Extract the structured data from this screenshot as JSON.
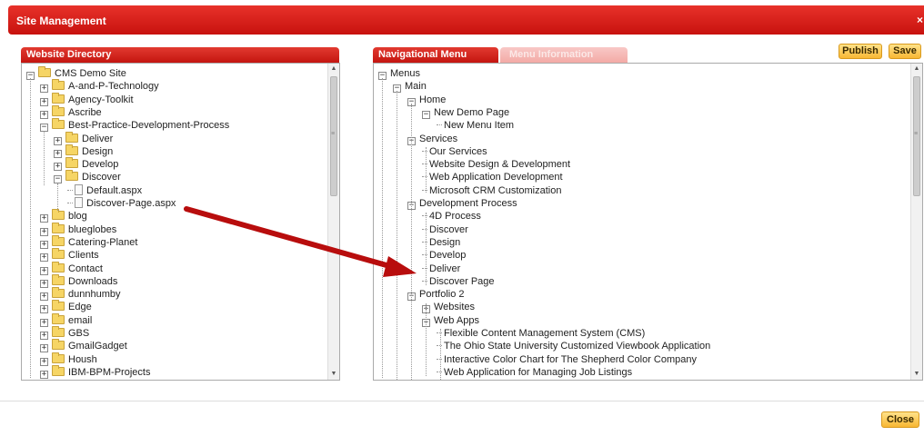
{
  "window": {
    "title": "Site Management",
    "close_label": "×"
  },
  "left_panel": {
    "tab": "Website Directory",
    "rows": [
      {
        "label": "CMS Demo Site",
        "indent": 0,
        "exp": "−",
        "icon": "folder"
      },
      {
        "label": "A-and-P-Technology",
        "indent": 1,
        "exp": "+",
        "icon": "folder"
      },
      {
        "label": "Agency-Toolkit",
        "indent": 1,
        "exp": "+",
        "icon": "folder"
      },
      {
        "label": "Ascribe",
        "indent": 1,
        "exp": "+",
        "icon": "folder"
      },
      {
        "label": "Best-Practice-Development-Process",
        "indent": 1,
        "exp": "−",
        "icon": "folder"
      },
      {
        "label": "Deliver",
        "indent": 2,
        "exp": "+",
        "icon": "folder"
      },
      {
        "label": "Design",
        "indent": 2,
        "exp": "+",
        "icon": "folder"
      },
      {
        "label": "Develop",
        "indent": 2,
        "exp": "+",
        "icon": "folder"
      },
      {
        "label": "Discover",
        "indent": 2,
        "exp": "−",
        "icon": "folder"
      },
      {
        "label": "Default.aspx",
        "indent": 3,
        "exp": "",
        "icon": "file"
      },
      {
        "label": "Discover-Page.aspx",
        "indent": 3,
        "exp": "",
        "icon": "file"
      },
      {
        "label": "blog",
        "indent": 1,
        "exp": "+",
        "icon": "folder"
      },
      {
        "label": "blueglobes",
        "indent": 1,
        "exp": "+",
        "icon": "folder"
      },
      {
        "label": "Catering-Planet",
        "indent": 1,
        "exp": "+",
        "icon": "folder"
      },
      {
        "label": "Clients",
        "indent": 1,
        "exp": "+",
        "icon": "folder"
      },
      {
        "label": "Contact",
        "indent": 1,
        "exp": "+",
        "icon": "folder"
      },
      {
        "label": "Downloads",
        "indent": 1,
        "exp": "+",
        "icon": "folder"
      },
      {
        "label": "dunnhumby",
        "indent": 1,
        "exp": "+",
        "icon": "folder"
      },
      {
        "label": "Edge",
        "indent": 1,
        "exp": "+",
        "icon": "folder"
      },
      {
        "label": "email",
        "indent": 1,
        "exp": "+",
        "icon": "folder"
      },
      {
        "label": "GBS",
        "indent": 1,
        "exp": "+",
        "icon": "folder"
      },
      {
        "label": "GmailGadget",
        "indent": 1,
        "exp": "+",
        "icon": "folder"
      },
      {
        "label": "Housh",
        "indent": 1,
        "exp": "+",
        "icon": "folder"
      },
      {
        "label": "IBM-BPM-Projects",
        "indent": 1,
        "exp": "+",
        "icon": "folder"
      }
    ]
  },
  "right_panel": {
    "tabs": [
      "Navigational Menu",
      "Menu Information"
    ],
    "publish_label": "Publish",
    "save_label": "Save",
    "rows": [
      {
        "label": "Menus",
        "indent": 0,
        "exp": "−"
      },
      {
        "label": "Main",
        "indent": 1,
        "exp": "−"
      },
      {
        "label": "Home",
        "indent": 2,
        "exp": "−"
      },
      {
        "label": "New Demo Page",
        "indent": 3,
        "exp": "−"
      },
      {
        "label": "New Menu Item",
        "indent": 4,
        "exp": ""
      },
      {
        "label": "Services",
        "indent": 2,
        "exp": "−"
      },
      {
        "label": "Our Services",
        "indent": 3,
        "exp": ""
      },
      {
        "label": "Website Design & Development",
        "indent": 3,
        "exp": ""
      },
      {
        "label": "Web Application Development",
        "indent": 3,
        "exp": ""
      },
      {
        "label": "Microsoft CRM Customization",
        "indent": 3,
        "exp": ""
      },
      {
        "label": "Development Process",
        "indent": 2,
        "exp": "−"
      },
      {
        "label": "4D Process",
        "indent": 3,
        "exp": ""
      },
      {
        "label": "Discover",
        "indent": 3,
        "exp": ""
      },
      {
        "label": "Design",
        "indent": 3,
        "exp": ""
      },
      {
        "label": "Develop",
        "indent": 3,
        "exp": ""
      },
      {
        "label": "Deliver",
        "indent": 3,
        "exp": ""
      },
      {
        "label": "Discover Page",
        "indent": 3,
        "exp": ""
      },
      {
        "label": "Portfolio 2",
        "indent": 2,
        "exp": "−"
      },
      {
        "label": "Websites",
        "indent": 3,
        "exp": "+"
      },
      {
        "label": "Web Apps",
        "indent": 3,
        "exp": "−"
      },
      {
        "label": "Flexible Content Management System (CMS)",
        "indent": 4,
        "exp": ""
      },
      {
        "label": "The Ohio State University Customized Viewbook Application",
        "indent": 4,
        "exp": ""
      },
      {
        "label": "Interactive Color Chart for The Shepherd Color Company",
        "indent": 4,
        "exp": ""
      },
      {
        "label": "Web Application for Managing Job Listings",
        "indent": 4,
        "exp": ""
      }
    ]
  },
  "footer": {
    "close_label": "Close"
  },
  "colors": {
    "accent_red": "#d0201a",
    "button_gold": "#f8b733",
    "arrow": "#b80d0d"
  }
}
